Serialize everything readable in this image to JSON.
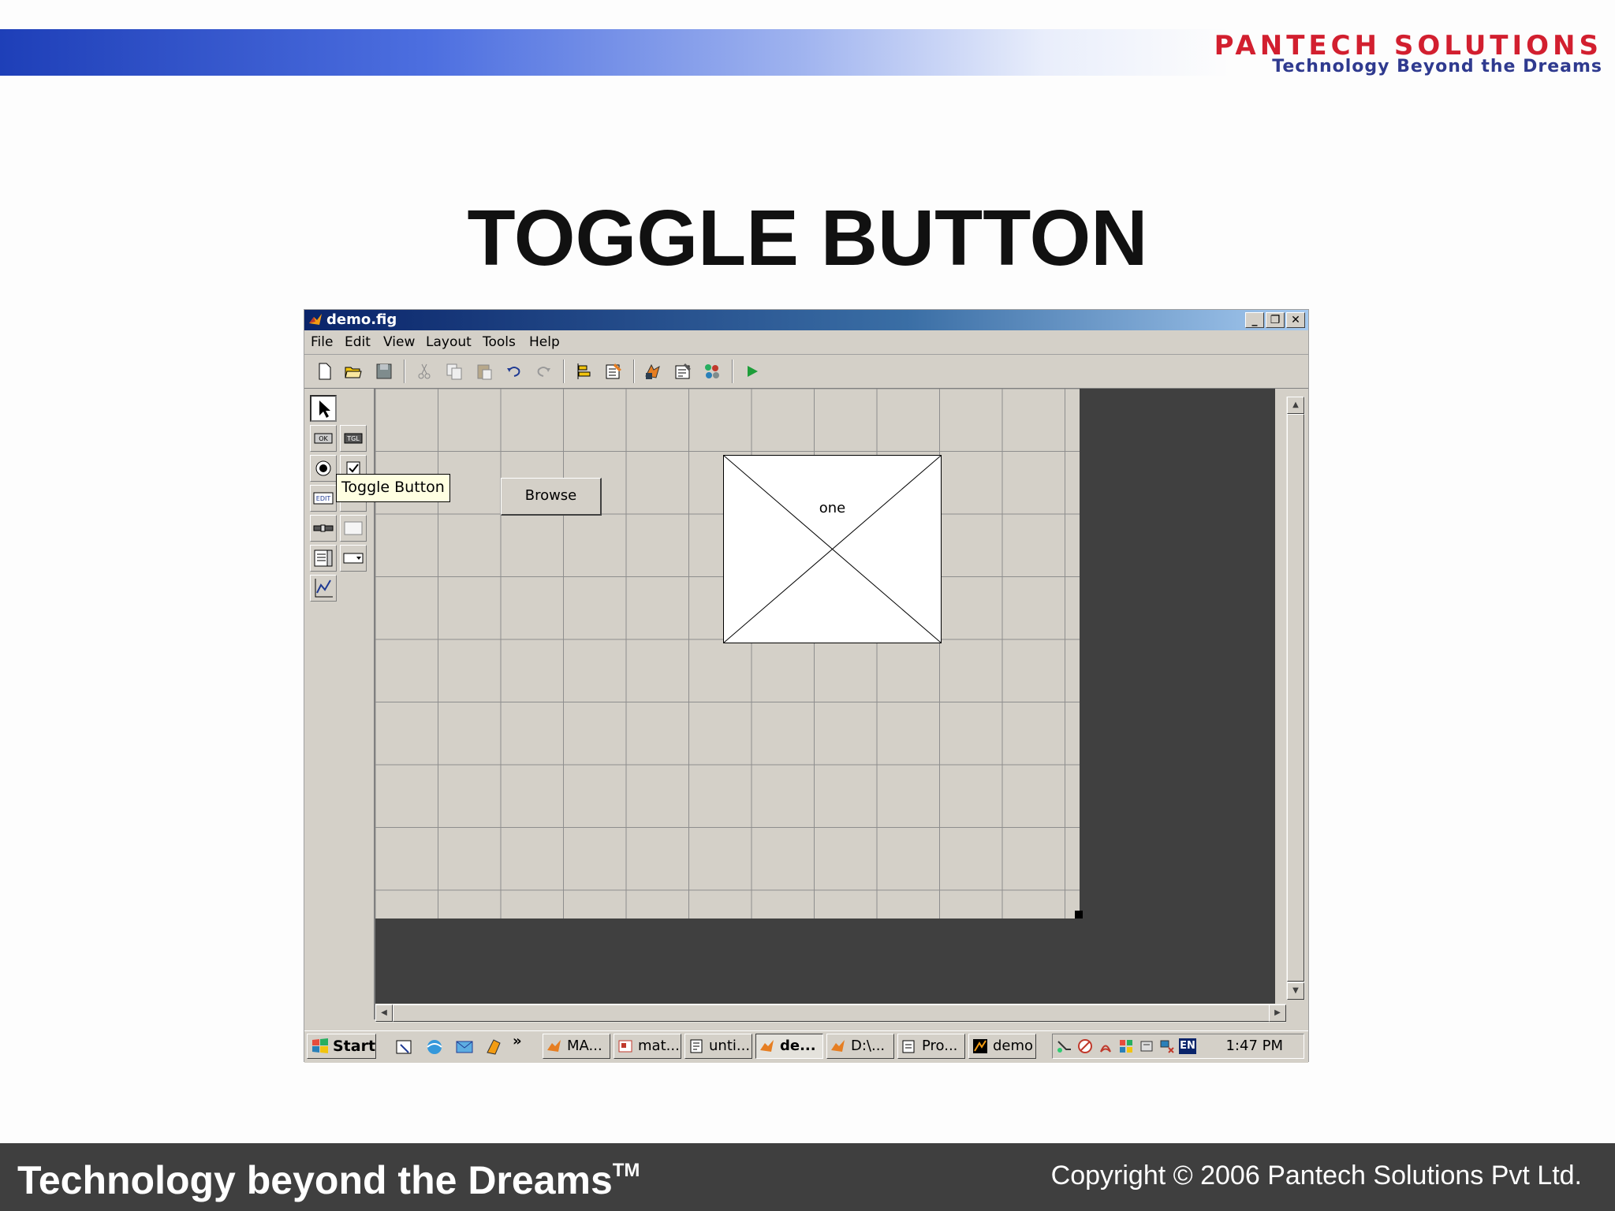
{
  "slide": {
    "title": "TOGGLE BUTTON",
    "logo_name": "PANTECH SOLUTIONS",
    "logo_tagline": "Technology Beyond the Dreams",
    "footer_tagline": "Technology beyond the Dreams",
    "footer_tm": "TM",
    "footer_copyright": "Copyright © 2006 Pantech Solutions Pvt Ltd."
  },
  "window": {
    "title": "demo.fig",
    "menu": [
      "File",
      "Edit",
      "View",
      "Layout",
      "Tools",
      "Help"
    ]
  },
  "toolbar_icons": [
    "new-file-icon",
    "open-folder-icon",
    "save-icon",
    "cut-icon",
    "copy-icon",
    "paste-icon",
    "undo-icon",
    "redo-icon",
    "align-icon",
    "menu-editor-icon",
    "property-inspector-icon",
    "object-browser-icon",
    "tab-order-icon",
    "run-icon"
  ],
  "palette_icons": [
    "select-arrow-icon",
    "push-button-icon",
    "toggle-button-icon",
    "radio-button-icon",
    "checkbox-icon",
    "edit-text-icon",
    "static-text-icon",
    "slider-icon",
    "frame-icon",
    "listbox-icon",
    "popup-menu-icon",
    "axes-icon"
  ],
  "canvas": {
    "browse_button": "Browse",
    "axes_label": "one",
    "tooltip": "Toggle Button"
  },
  "taskbar": {
    "start": "Start",
    "tasks": [
      "MA...",
      "mat...",
      "unti...",
      "de...",
      "D:\\...",
      "Pro...",
      "demo"
    ],
    "active_task_index": 3,
    "tray_lang": "EN",
    "clock": "1:47 PM"
  },
  "colors": {
    "header_blue": "#1e3fb8",
    "logo_red": "#d21f2f",
    "footer_bg": "#3f3f3f",
    "tooltip_bg": "#ffffe1",
    "win_face": "#d4d0c8"
  }
}
